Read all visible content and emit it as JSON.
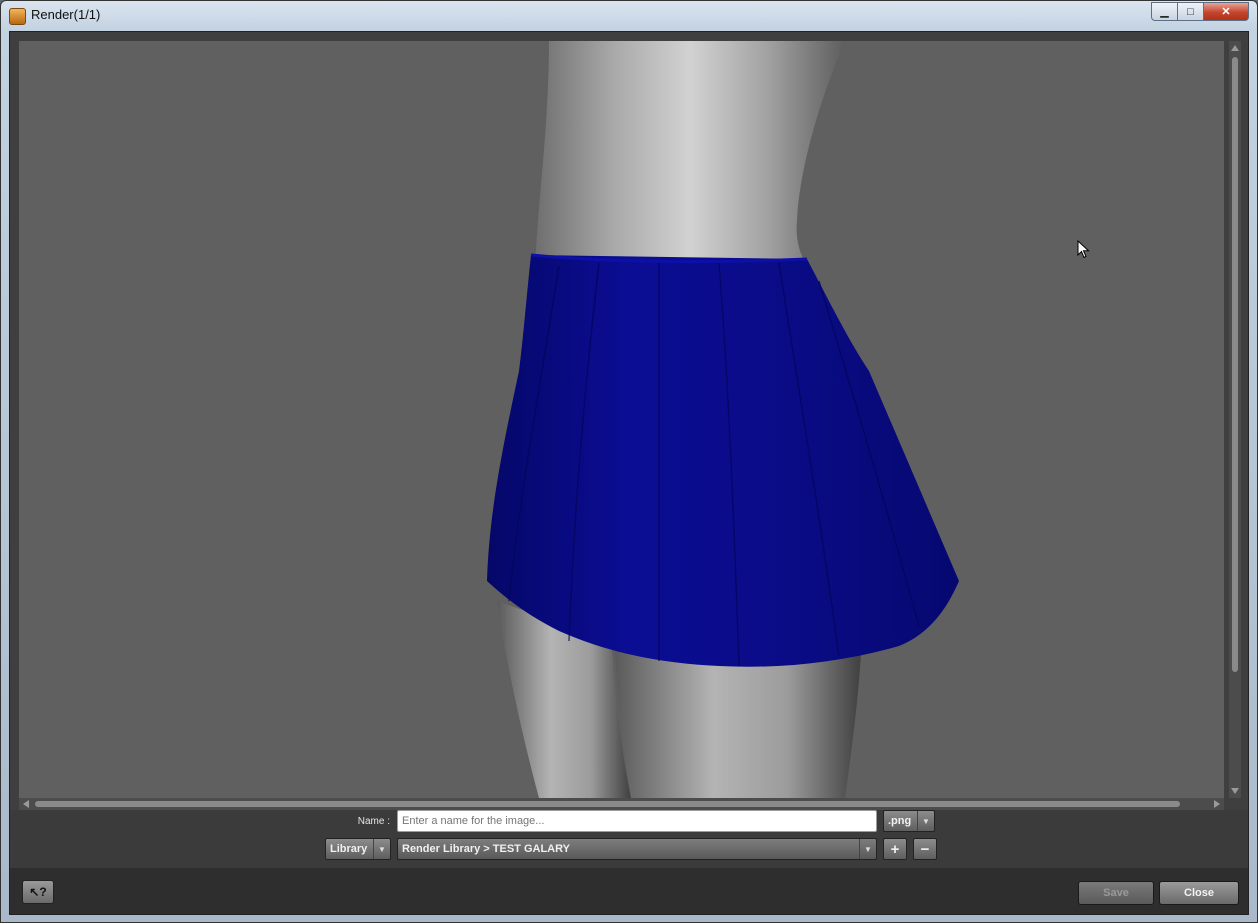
{
  "window": {
    "title": "Render(1/1)",
    "minimize_symbol": "▁",
    "maximize_symbol": "□",
    "close_symbol": "✕"
  },
  "viewport": {
    "background_color": "#606060",
    "figure_body_color": "#9a9a9a",
    "skirt_color": "#0a0c8e"
  },
  "form": {
    "name_label": "Name :",
    "name_placeholder": "Enter a name for the image...",
    "name_value": "",
    "format_selected": ".png",
    "library_selected": "Library",
    "path_selected": "Render Library > TEST GALARY",
    "add_symbol": "+",
    "remove_symbol": "−"
  },
  "footer": {
    "help_symbol": "?",
    "save_label": "Save",
    "close_label": "Close"
  }
}
